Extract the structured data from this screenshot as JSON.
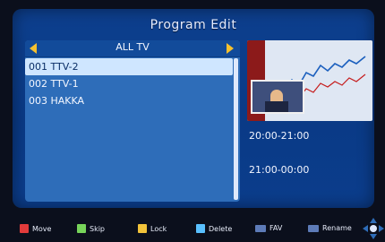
{
  "title": "Program Edit",
  "group": {
    "name": "ALL TV",
    "left_icon": "triangle-left",
    "right_icon": "triangle-right"
  },
  "channels": [
    {
      "label": "001 TTV-2",
      "selected": true
    },
    {
      "label": "002 TTV-1",
      "selected": false
    },
    {
      "label": "003 HAKKA",
      "selected": false
    }
  ],
  "epg": {
    "slot1": "20:00-21:00",
    "slot2": "21:00-00:00"
  },
  "hints": [
    {
      "label": "Move",
      "color": "#e23b3b"
    },
    {
      "label": "Skip",
      "color": "#77d45a"
    },
    {
      "label": "Lock",
      "color": "#f2c33a"
    },
    {
      "label": "Delete",
      "color": "#59c0ff"
    },
    {
      "label": "FAV",
      "color": "#5d7bb8"
    },
    {
      "label": "Rename",
      "color": "#5d7bb8"
    }
  ],
  "icons": {
    "dpad": "dpad-icon"
  }
}
